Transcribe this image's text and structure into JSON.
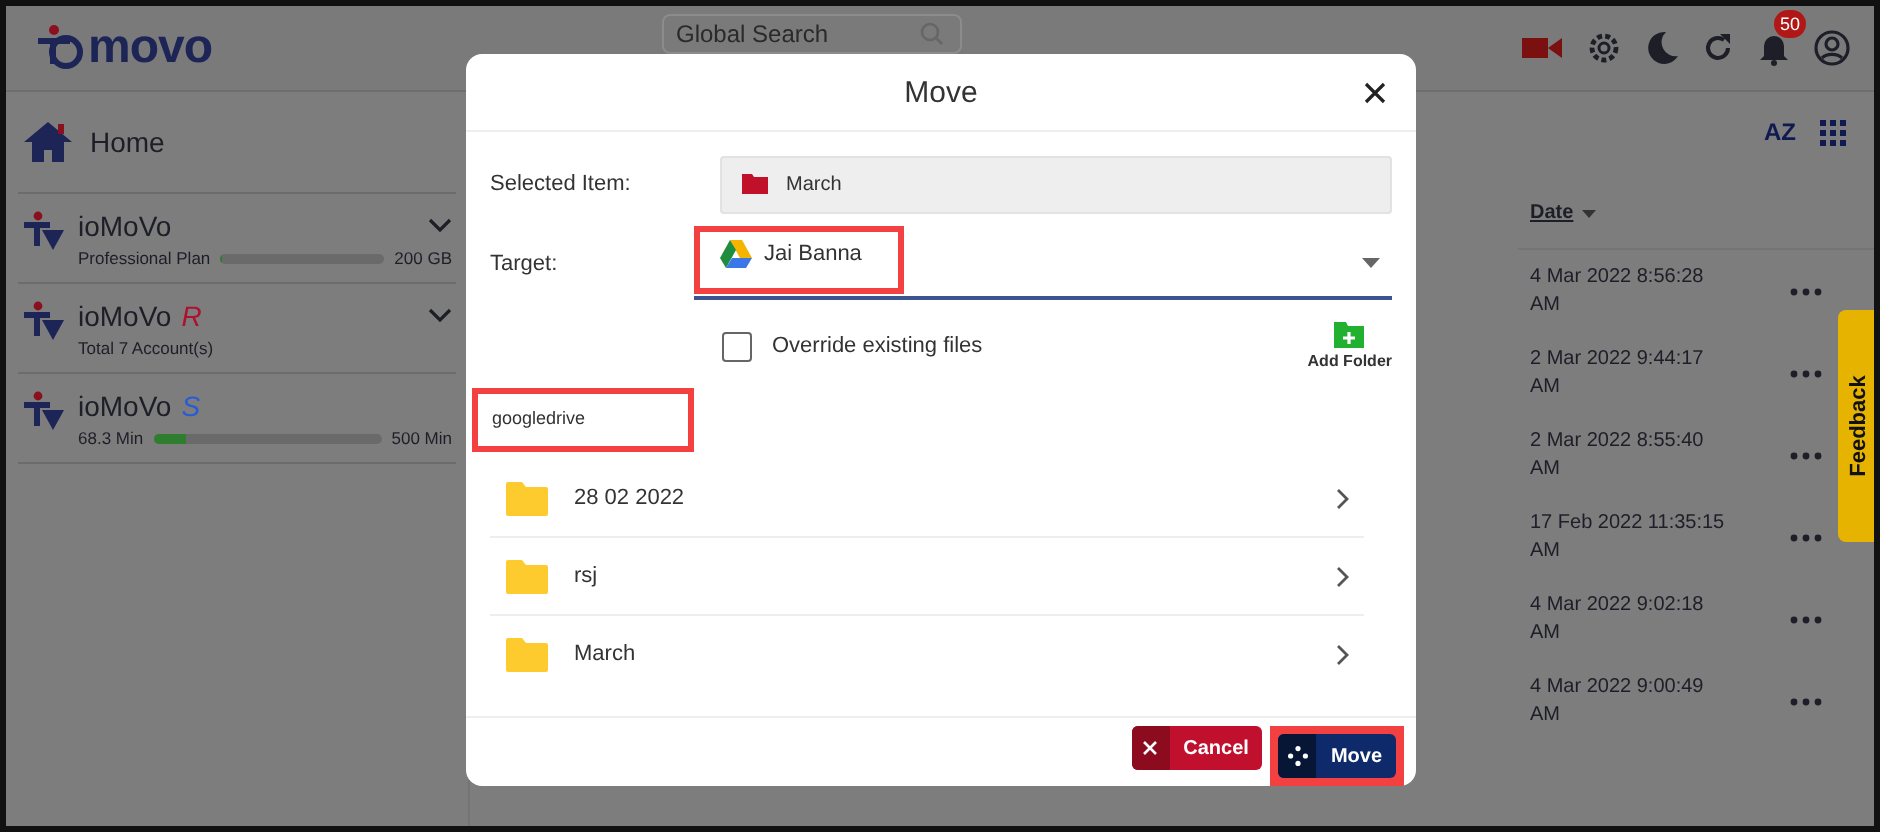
{
  "header": {
    "logo": "movo",
    "search": {
      "placeholder": "Global Search"
    },
    "notifications_badge": "50"
  },
  "sidebar": {
    "home": "Home",
    "accounts": [
      {
        "name": "ioMoVo",
        "subtitle": "Professional Plan",
        "level": 0.01,
        "cap": "200 GB",
        "expanded": false
      },
      {
        "name": "ioMoVo",
        "suffix": "R",
        "color": "#b01030",
        "subtitle": "Total 7 Account(s)",
        "expanded": false
      },
      {
        "name": "ioMoVo",
        "suffix": "S",
        "color": "#2a5bd7",
        "subtitle": "68.3 Min",
        "level": 0.14,
        "cap": "500 Min"
      }
    ]
  },
  "toolbar": {
    "sort_label": "AZ"
  },
  "table": {
    "column": "Date",
    "rows": [
      "4 Mar 2022 8:56:28 AM",
      "2 Mar 2022 9:44:17 AM",
      "2 Mar 2022 8:55:40 AM",
      "17 Feb 2022 11:35:15 AM",
      "4 Mar 2022 9:02:18 AM",
      "4 Mar 2022 9:00:49 AM"
    ]
  },
  "feedback": "Feedback",
  "dialog": {
    "title": "Move",
    "selected_label": "Selected Item:",
    "selected_value": "March",
    "target_label": "Target:",
    "target_value": "Jai Banna",
    "override": {
      "label": "Override existing files",
      "checked": false
    },
    "add_folder": "Add Folder",
    "source": "googledrive",
    "folders": [
      "28 02 2022",
      "rsj",
      "March"
    ],
    "cancel": "Cancel",
    "move": "Move"
  }
}
